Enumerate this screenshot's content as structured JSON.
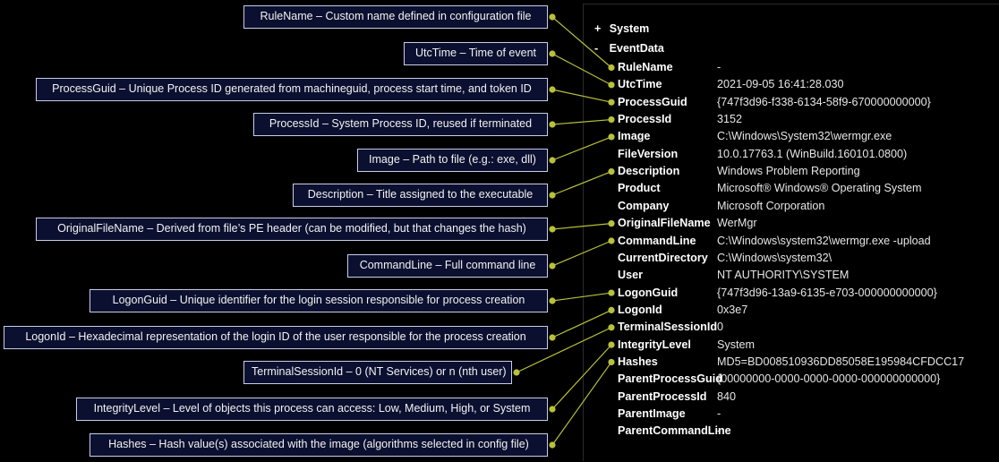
{
  "tree": {
    "system_toggle": "+",
    "system_label": "System",
    "eventdata_toggle": "-",
    "eventdata_label": "EventData"
  },
  "fields": [
    {
      "key": "RuleName",
      "value": "-"
    },
    {
      "key": "UtcTime",
      "value": "2021-09-05 16:41:28.030"
    },
    {
      "key": "ProcessGuid",
      "value": "{747f3d96-f338-6134-58f9-670000000000}"
    },
    {
      "key": "ProcessId",
      "value": "3152"
    },
    {
      "key": "Image",
      "value": "C:\\Windows\\System32\\wermgr.exe"
    },
    {
      "key": "FileVersion",
      "value": "10.0.17763.1 (WinBuild.160101.0800)"
    },
    {
      "key": "Description",
      "value": "Windows Problem Reporting"
    },
    {
      "key": "Product",
      "value": "Microsoft® Windows® Operating System"
    },
    {
      "key": "Company",
      "value": "Microsoft Corporation"
    },
    {
      "key": "OriginalFileName",
      "value": "WerMgr"
    },
    {
      "key": "CommandLine",
      "value": "C:\\Windows\\system32\\wermgr.exe -upload"
    },
    {
      "key": "CurrentDirectory",
      "value": "C:\\Windows\\system32\\"
    },
    {
      "key": "User",
      "value": "NT AUTHORITY\\SYSTEM"
    },
    {
      "key": "LogonGuid",
      "value": "{747f3d96-13a9-6135-e703-000000000000}"
    },
    {
      "key": "LogonId",
      "value": "0x3e7"
    },
    {
      "key": "TerminalSessionId",
      "value": "0"
    },
    {
      "key": "IntegrityLevel",
      "value": "System"
    },
    {
      "key": "Hashes",
      "value": "MD5=BD008510936DD85058E195984CFDCC17"
    },
    {
      "key": "ParentProcessGuid",
      "value": "{00000000-0000-0000-0000-000000000000}"
    },
    {
      "key": "ParentProcessId",
      "value": "840"
    },
    {
      "key": "ParentImage",
      "value": "-"
    },
    {
      "key": "ParentCommandLine",
      "value": "-"
    }
  ],
  "callouts": [
    {
      "text": "RuleName – Custom name defined in configuration file",
      "field": 0
    },
    {
      "text": "UtcTime – Time of event",
      "field": 1
    },
    {
      "text": "ProcessGuid – Unique Process ID generated from machineguid, process start time, and token ID",
      "field": 2
    },
    {
      "text": "ProcessId – System Process ID, reused if terminated",
      "field": 3
    },
    {
      "text": "Image – Path to file (e.g.: exe, dll)",
      "field": 4
    },
    {
      "text": "Description – Title assigned to the executable",
      "field": 6
    },
    {
      "text": "OriginalFileName – Derived from file’s PE header (can be modified, but that changes the hash)",
      "field": 9
    },
    {
      "text": "CommandLine – Full command line",
      "field": 10
    },
    {
      "text": "LogonGuid – Unique identifier for the login session responsible for process creation",
      "field": 13
    },
    {
      "text": "LogonId – Hexadecimal representation of the login ID of the user responsible for the process creation",
      "field": 14
    },
    {
      "text": "TerminalSessionId – 0 (NT Services) or n (nth user)",
      "field": 15
    },
    {
      "text": "IntegrityLevel – Level of objects this process can access: Low, Medium, High, or System",
      "field": 16
    },
    {
      "text": "Hashes – Hash value(s) associated with the image (algorithms selected  in config file)",
      "field": 17
    }
  ],
  "colors": {
    "connector": "#b9c13a",
    "callout_bg": "#0b1030",
    "callout_border": "#c8cde6"
  }
}
